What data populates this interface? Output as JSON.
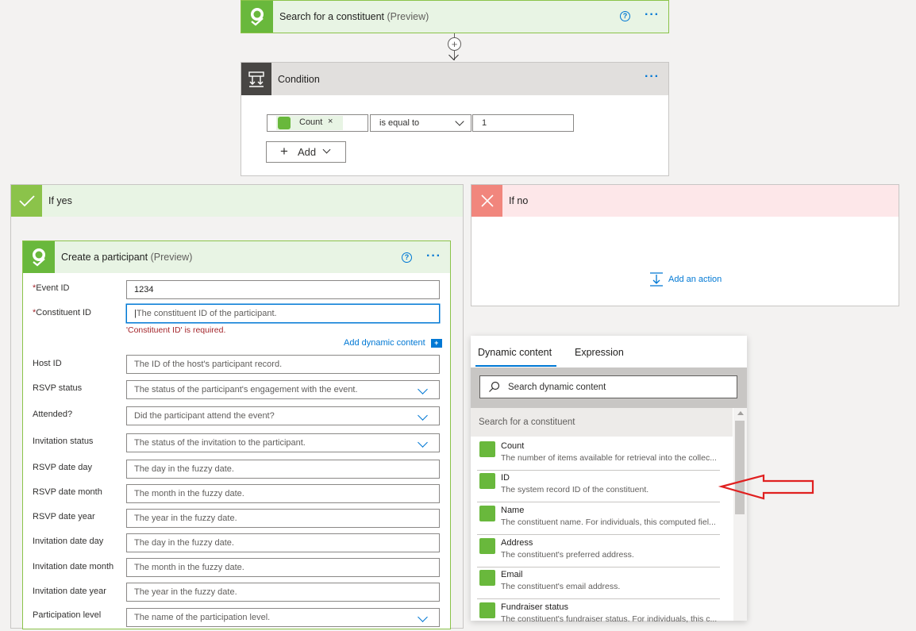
{
  "search_step": {
    "title": "Search for a constituent",
    "preview": "(Preview)"
  },
  "condition": {
    "title": "Condition",
    "token_label": "Count",
    "operator": "is equal to",
    "value": "1",
    "add_label": "Add"
  },
  "if_yes": {
    "title": "If yes"
  },
  "if_no": {
    "title": "If no",
    "add_action": "Add an action"
  },
  "create_participant": {
    "title": "Create a participant",
    "preview": "(Preview)",
    "required_error": "'Constituent ID' is required.",
    "add_dynamic": "Add dynamic content",
    "fields": [
      {
        "label": "Event ID",
        "required": "*",
        "value": "1234",
        "placeholder": ""
      },
      {
        "label": "Constituent ID",
        "required": "*",
        "value": "",
        "placeholder": "The constituent ID of the participant."
      },
      {
        "label": "Host ID",
        "required": "",
        "value": "",
        "placeholder": "The ID of the host's participant record."
      },
      {
        "label": "RSVP status",
        "required": "",
        "value": "",
        "placeholder": "The status of the participant's engagement with the event."
      },
      {
        "label": "Attended?",
        "required": "",
        "value": "",
        "placeholder": "Did the participant attend the event?"
      },
      {
        "label": "Invitation status",
        "required": "",
        "value": "",
        "placeholder": "The status of the invitation to the participant."
      },
      {
        "label": "RSVP date day",
        "required": "",
        "value": "",
        "placeholder": "The day in the fuzzy date."
      },
      {
        "label": "RSVP date month",
        "required": "",
        "value": "",
        "placeholder": "The month in the fuzzy date."
      },
      {
        "label": "RSVP date year",
        "required": "",
        "value": "",
        "placeholder": "The year in the fuzzy date."
      },
      {
        "label": "Invitation date day",
        "required": "",
        "value": "",
        "placeholder": "The day in the fuzzy date."
      },
      {
        "label": "Invitation date month",
        "required": "",
        "value": "",
        "placeholder": "The month in the fuzzy date."
      },
      {
        "label": "Invitation date year",
        "required": "",
        "value": "",
        "placeholder": "The year in the fuzzy date."
      },
      {
        "label": "Participation level",
        "required": "",
        "value": "",
        "placeholder": "The name of the participation level."
      }
    ]
  },
  "dynamic_panel": {
    "tabs": [
      "Dynamic content",
      "Expression"
    ],
    "search_placeholder": "Search dynamic content",
    "section_title": "Search for a constituent",
    "items": [
      {
        "name": "Count",
        "desc": "The number of items available for retrieval into the collec..."
      },
      {
        "name": "ID",
        "desc": "The system record ID of the constituent."
      },
      {
        "name": "Name",
        "desc": "The constituent name. For individuals, this computed fiel..."
      },
      {
        "name": "Address",
        "desc": "The constituent's preferred address."
      },
      {
        "name": "Email",
        "desc": "The constituent's email address."
      },
      {
        "name": "Fundraiser status",
        "desc": "The constituent's fundraiser status. For individuals, this c..."
      }
    ]
  },
  "colors": {
    "accent": "#0078d4",
    "green": "#69b83c",
    "red_arrow": "#e02020"
  }
}
